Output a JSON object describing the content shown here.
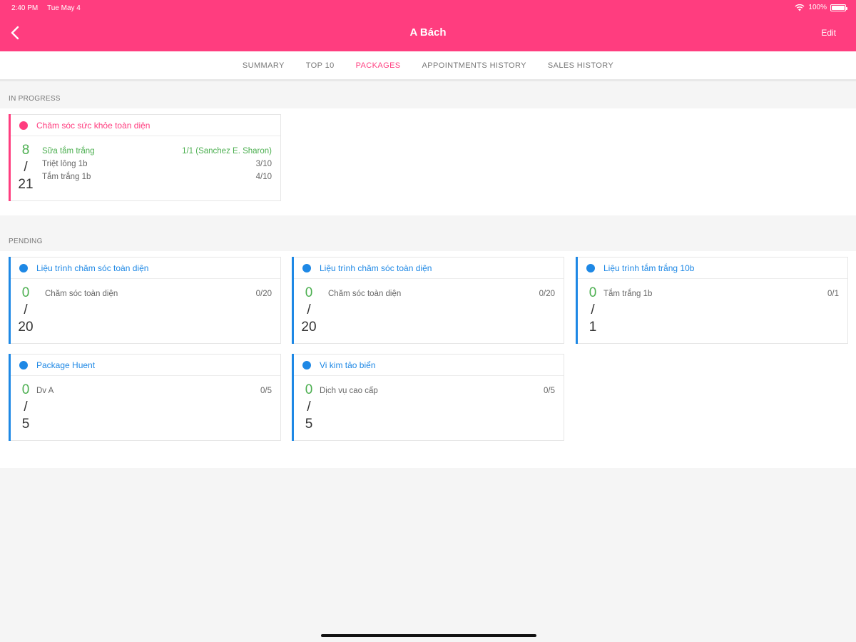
{
  "status_bar": {
    "time": "2:40 PM",
    "date": "Tue May 4",
    "battery": "100%"
  },
  "header": {
    "title": "A Bách",
    "edit_label": "Edit"
  },
  "tabs": [
    {
      "label": "SUMMARY"
    },
    {
      "label": "TOP 10"
    },
    {
      "label": "PACKAGES"
    },
    {
      "label": "APPOINTMENTS HISTORY"
    },
    {
      "label": "SALES HISTORY"
    }
  ],
  "colors": {
    "brand": "#ff3d7f",
    "in_progress": "#ff3d7f",
    "pending": "#1e88e5",
    "done": "#4caf50"
  },
  "in_progress": {
    "label": "IN PROGRESS",
    "cards": [
      {
        "title": "Chăm sóc sức khỏe toàn diện",
        "done": "8",
        "slash": "/",
        "total": "21",
        "items": [
          {
            "name": "Sữa tắm trắng",
            "value": "1/1 (Sanchez E. Sharon)"
          },
          {
            "name": "Triệt lông 1b",
            "value": "3/10"
          },
          {
            "name": "Tắm trắng 1b",
            "value": "4/10"
          }
        ]
      }
    ]
  },
  "pending": {
    "label": "PENDING",
    "cards": [
      {
        "title": "Liệu trình chăm sóc toàn diện",
        "done": "0",
        "slash": "/",
        "total": "20",
        "items": [
          {
            "name": "Chăm sóc toàn diện",
            "value": "0/20"
          }
        ]
      },
      {
        "title": "Liệu trình chăm sóc toàn diện",
        "done": "0",
        "slash": "/",
        "total": "20",
        "items": [
          {
            "name": "Chăm sóc toàn diện",
            "value": "0/20"
          }
        ]
      },
      {
        "title": "Liệu trình tắm trắng 10b",
        "done": "0",
        "slash": "/",
        "total": "1",
        "items": [
          {
            "name": "Tắm trắng 1b",
            "value": "0/1"
          }
        ]
      },
      {
        "title": "Package Huent",
        "done": "0",
        "slash": "/",
        "total": "5",
        "items": [
          {
            "name": "Dv A",
            "value": "0/5"
          }
        ]
      },
      {
        "title": "Vi kim tảo biển",
        "done": "0",
        "slash": "/",
        "total": "5",
        "items": [
          {
            "name": "Dịch vụ cao cấp",
            "value": "0/5"
          }
        ]
      }
    ]
  }
}
